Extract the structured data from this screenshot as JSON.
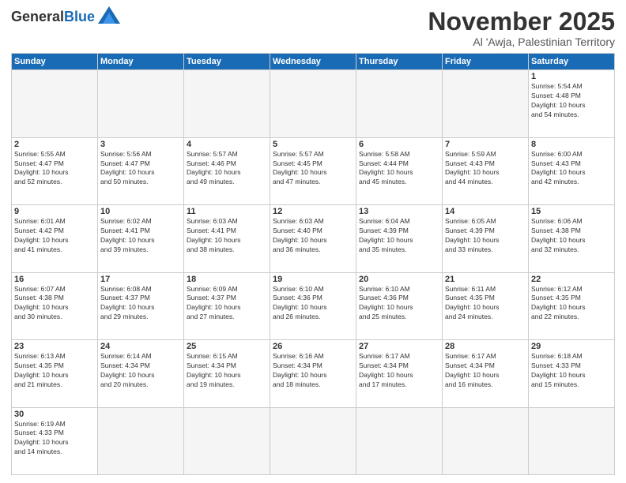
{
  "header": {
    "logo": {
      "general": "General",
      "blue": "Blue"
    },
    "title": "November 2025",
    "location": "Al 'Awja, Palestinian Territory"
  },
  "weekdays": [
    "Sunday",
    "Monday",
    "Tuesday",
    "Wednesday",
    "Thursday",
    "Friday",
    "Saturday"
  ],
  "weeks": [
    [
      {
        "day": "",
        "info": ""
      },
      {
        "day": "",
        "info": ""
      },
      {
        "day": "",
        "info": ""
      },
      {
        "day": "",
        "info": ""
      },
      {
        "day": "",
        "info": ""
      },
      {
        "day": "",
        "info": ""
      },
      {
        "day": "1",
        "info": "Sunrise: 5:54 AM\nSunset: 4:48 PM\nDaylight: 10 hours\nand 54 minutes."
      }
    ],
    [
      {
        "day": "2",
        "info": "Sunrise: 5:55 AM\nSunset: 4:47 PM\nDaylight: 10 hours\nand 52 minutes."
      },
      {
        "day": "3",
        "info": "Sunrise: 5:56 AM\nSunset: 4:47 PM\nDaylight: 10 hours\nand 50 minutes."
      },
      {
        "day": "4",
        "info": "Sunrise: 5:57 AM\nSunset: 4:46 PM\nDaylight: 10 hours\nand 49 minutes."
      },
      {
        "day": "5",
        "info": "Sunrise: 5:57 AM\nSunset: 4:45 PM\nDaylight: 10 hours\nand 47 minutes."
      },
      {
        "day": "6",
        "info": "Sunrise: 5:58 AM\nSunset: 4:44 PM\nDaylight: 10 hours\nand 45 minutes."
      },
      {
        "day": "7",
        "info": "Sunrise: 5:59 AM\nSunset: 4:43 PM\nDaylight: 10 hours\nand 44 minutes."
      },
      {
        "day": "8",
        "info": "Sunrise: 6:00 AM\nSunset: 4:43 PM\nDaylight: 10 hours\nand 42 minutes."
      }
    ],
    [
      {
        "day": "9",
        "info": "Sunrise: 6:01 AM\nSunset: 4:42 PM\nDaylight: 10 hours\nand 41 minutes."
      },
      {
        "day": "10",
        "info": "Sunrise: 6:02 AM\nSunset: 4:41 PM\nDaylight: 10 hours\nand 39 minutes."
      },
      {
        "day": "11",
        "info": "Sunrise: 6:03 AM\nSunset: 4:41 PM\nDaylight: 10 hours\nand 38 minutes."
      },
      {
        "day": "12",
        "info": "Sunrise: 6:03 AM\nSunset: 4:40 PM\nDaylight: 10 hours\nand 36 minutes."
      },
      {
        "day": "13",
        "info": "Sunrise: 6:04 AM\nSunset: 4:39 PM\nDaylight: 10 hours\nand 35 minutes."
      },
      {
        "day": "14",
        "info": "Sunrise: 6:05 AM\nSunset: 4:39 PM\nDaylight: 10 hours\nand 33 minutes."
      },
      {
        "day": "15",
        "info": "Sunrise: 6:06 AM\nSunset: 4:38 PM\nDaylight: 10 hours\nand 32 minutes."
      }
    ],
    [
      {
        "day": "16",
        "info": "Sunrise: 6:07 AM\nSunset: 4:38 PM\nDaylight: 10 hours\nand 30 minutes."
      },
      {
        "day": "17",
        "info": "Sunrise: 6:08 AM\nSunset: 4:37 PM\nDaylight: 10 hours\nand 29 minutes."
      },
      {
        "day": "18",
        "info": "Sunrise: 6:09 AM\nSunset: 4:37 PM\nDaylight: 10 hours\nand 27 minutes."
      },
      {
        "day": "19",
        "info": "Sunrise: 6:10 AM\nSunset: 4:36 PM\nDaylight: 10 hours\nand 26 minutes."
      },
      {
        "day": "20",
        "info": "Sunrise: 6:10 AM\nSunset: 4:36 PM\nDaylight: 10 hours\nand 25 minutes."
      },
      {
        "day": "21",
        "info": "Sunrise: 6:11 AM\nSunset: 4:35 PM\nDaylight: 10 hours\nand 24 minutes."
      },
      {
        "day": "22",
        "info": "Sunrise: 6:12 AM\nSunset: 4:35 PM\nDaylight: 10 hours\nand 22 minutes."
      }
    ],
    [
      {
        "day": "23",
        "info": "Sunrise: 6:13 AM\nSunset: 4:35 PM\nDaylight: 10 hours\nand 21 minutes."
      },
      {
        "day": "24",
        "info": "Sunrise: 6:14 AM\nSunset: 4:34 PM\nDaylight: 10 hours\nand 20 minutes."
      },
      {
        "day": "25",
        "info": "Sunrise: 6:15 AM\nSunset: 4:34 PM\nDaylight: 10 hours\nand 19 minutes."
      },
      {
        "day": "26",
        "info": "Sunrise: 6:16 AM\nSunset: 4:34 PM\nDaylight: 10 hours\nand 18 minutes."
      },
      {
        "day": "27",
        "info": "Sunrise: 6:17 AM\nSunset: 4:34 PM\nDaylight: 10 hours\nand 17 minutes."
      },
      {
        "day": "28",
        "info": "Sunrise: 6:17 AM\nSunset: 4:34 PM\nDaylight: 10 hours\nand 16 minutes."
      },
      {
        "day": "29",
        "info": "Sunrise: 6:18 AM\nSunset: 4:33 PM\nDaylight: 10 hours\nand 15 minutes."
      }
    ],
    [
      {
        "day": "30",
        "info": "Sunrise: 6:19 AM\nSunset: 4:33 PM\nDaylight: 10 hours\nand 14 minutes."
      },
      {
        "day": "",
        "info": ""
      },
      {
        "day": "",
        "info": ""
      },
      {
        "day": "",
        "info": ""
      },
      {
        "day": "",
        "info": ""
      },
      {
        "day": "",
        "info": ""
      },
      {
        "day": "",
        "info": ""
      }
    ]
  ]
}
